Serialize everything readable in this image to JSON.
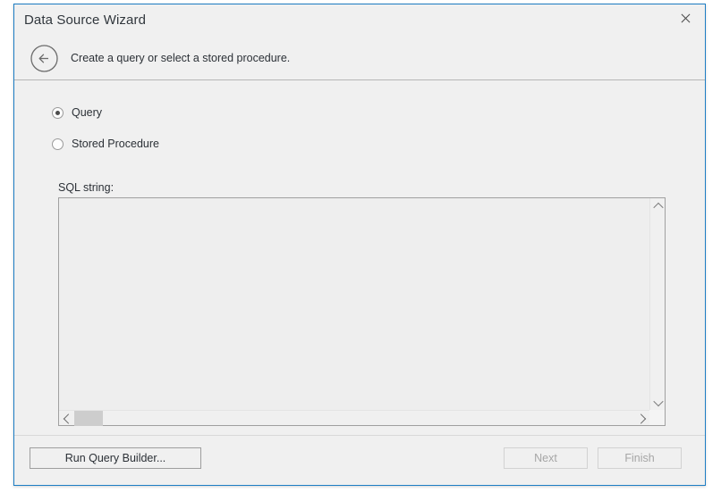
{
  "window": {
    "title": "Data Source Wizard",
    "close_label": "×",
    "accent_color": "#1d7dc4",
    "background_color": "#f0f0f0"
  },
  "header": {
    "back_icon": "circle-left-arrow-icon",
    "subtitle": "Create a query or select a stored procedure."
  },
  "main": {
    "options": [
      {
        "label": "Query",
        "selected": true
      },
      {
        "label": "Stored Procedure",
        "selected": false
      }
    ],
    "sql": {
      "label": "SQL string:",
      "value": "",
      "placeholder": ""
    },
    "scrollbars": {
      "up_icon": "chevron-up-icon",
      "down_icon": "chevron-down-icon",
      "left_icon": "chevron-left-icon",
      "right_icon": "chevron-right-icon"
    }
  },
  "footer": {
    "query_builder_label": "Run Query Builder...",
    "next_label": "Next",
    "next_enabled": false,
    "finish_label": "Finish",
    "finish_enabled": false
  }
}
